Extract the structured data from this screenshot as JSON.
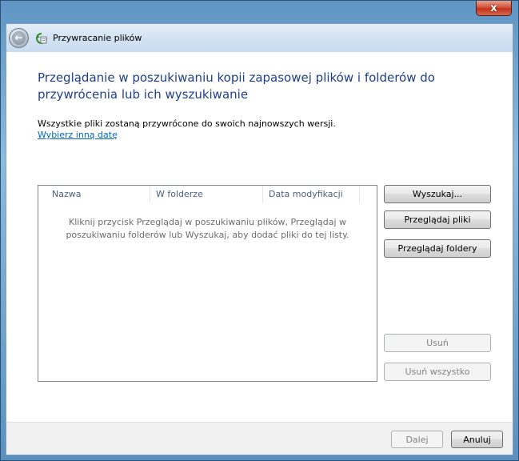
{
  "window": {
    "close_label": "x"
  },
  "navbar": {
    "back_label": "←",
    "title": "Przywracanie plików"
  },
  "content": {
    "heading": "Przeglądanie w poszukiwaniu kopii zapasowej plików i folderów do przywrócenia lub ich wyszukiwanie",
    "info_text": "Wszystkie pliki zostaną przywrócone do swoich najnowszych wersji.",
    "date_link": "Wybierz inną datę"
  },
  "file_list": {
    "columns": [
      "Nazwa",
      "W folderze",
      "Data modyfikacji"
    ],
    "empty_message": "Kliknij przycisk Przeglądaj w poszukiwaniu plików, Przeglądaj w poszukiwaniu folderów lub Wyszukaj, aby dodać pliki do tej listy."
  },
  "actions": {
    "search": "Wyszukaj...",
    "browse_files": "Przeglądaj pliki",
    "browse_folders": "Przeglądaj foldery",
    "remove": "Usuń",
    "remove_all": "Usuń wszystko"
  },
  "footer": {
    "next": "Dalej",
    "cancel": "Anuluj"
  },
  "colors": {
    "heading": "#1e3f8a",
    "link": "#0066cc",
    "close_button": "#c0321d"
  }
}
